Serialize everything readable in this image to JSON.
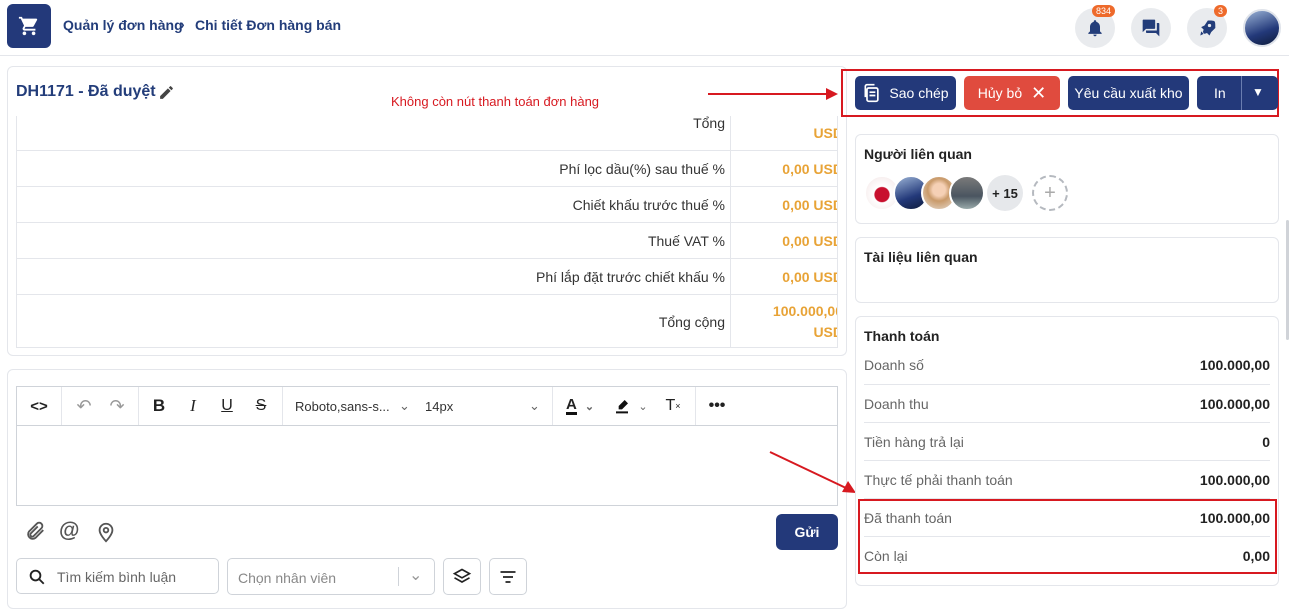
{
  "breadcrumb": {
    "parent": "Quản lý đơn hàng",
    "current": "Chi tiết Đơn hàng bán"
  },
  "notifications": {
    "bell_count": "834",
    "rocket_count": "3"
  },
  "order": {
    "title": "DH1171 - Đã duyệt"
  },
  "annotation": {
    "note": "Không còn nút thanh toán đơn hàng"
  },
  "actions": {
    "copy": "Sao chép",
    "cancel": "Hủy bỏ",
    "export": "Yêu cầu xuất kho",
    "print": "In"
  },
  "summary": {
    "partial_label": "Tổng",
    "partial_value": "USD",
    "rows": [
      {
        "label": "Phí lọc dầu(%) sau thuế %",
        "value": "0,00 USD"
      },
      {
        "label": "Chiết khấu trước thuế %",
        "value": "0,00 USD"
      },
      {
        "label": "Thuế VAT %",
        "value": "0,00 USD"
      },
      {
        "label": "Phí lắp đặt trước chiết khấu %",
        "value": "0,00 USD"
      }
    ],
    "total_label": "Tổng cộng",
    "total_value_1": "100.000,00",
    "total_value_2": "USD"
  },
  "editor": {
    "font": "Roboto,sans-s...",
    "size": "14px",
    "send": "Gửi"
  },
  "comments": {
    "search_placeholder": "Tìm kiếm bình luận",
    "employee_placeholder": "Chọn nhân viên"
  },
  "related_people": {
    "title": "Người liên quan",
    "more": "+ 15"
  },
  "related_docs": {
    "title": "Tài liệu liên quan"
  },
  "payment": {
    "title": "Thanh toán",
    "rows": [
      {
        "label": "Doanh số",
        "value": "100.000,00"
      },
      {
        "label": "Doanh thu",
        "value": "100.000,00"
      },
      {
        "label": "Tiền hàng trả lại",
        "value": "0"
      },
      {
        "label": "Thực tế phải thanh toán",
        "value": "100.000,00"
      },
      {
        "label": "Đã thanh toán",
        "value": "100.000,00"
      },
      {
        "label": "Còn lại",
        "value": "0,00"
      }
    ]
  },
  "colors": {
    "navy": "#23397a",
    "danger": "#e04b3e",
    "amount": "#e8a336",
    "highlight": "#d71920"
  }
}
